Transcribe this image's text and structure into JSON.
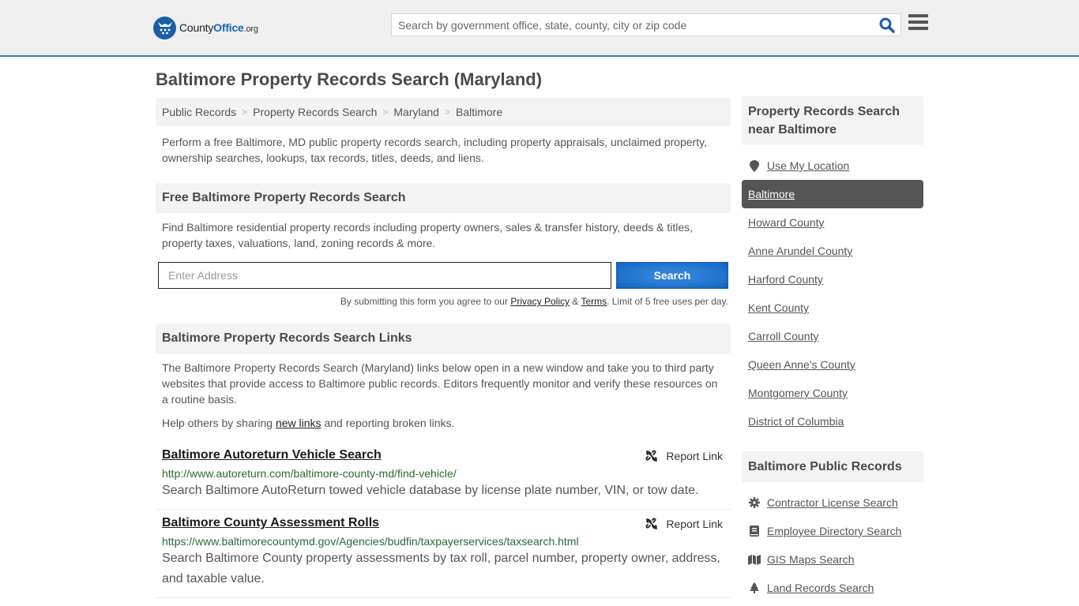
{
  "header": {
    "logo": {
      "name_plain": "County",
      "name_brand": "Office",
      "tld": ".org"
    },
    "search_placeholder": "Search by government office, state, county, city or zip code",
    "search_icon": "search-icon",
    "menu_icon": "hamburger-menu-icon",
    "accent_color": "#3a7ead"
  },
  "page_title": "Baltimore Property Records Search (Maryland)",
  "breadcrumb": [
    {
      "label": "Public Records"
    },
    {
      "label": "Property Records Search"
    },
    {
      "label": "Maryland"
    },
    {
      "label": "Baltimore"
    }
  ],
  "breadcrumb_separator": ">",
  "intro": "Perform a free Baltimore, MD public property records search, including property appraisals, unclaimed property, ownership searches, lookups, tax records, titles, deeds, and liens.",
  "search_section": {
    "heading": "Free Baltimore Property Records Search",
    "description": "Find Baltimore residential property records including property owners, sales & transfer history, deeds & titles, property taxes, valuations, land, zoning records & more.",
    "address_placeholder": "Enter Address",
    "button_label": "Search",
    "button_color": "#1a6fcf",
    "terms_prefix": "By submitting this form you agree to our ",
    "privacy_label": "Privacy Policy",
    "terms_amp": " & ",
    "terms_label": "Terms",
    "terms_suffix": ". Limit of 5 free uses per day."
  },
  "links_section": {
    "heading": "Baltimore Property Records Search Links",
    "description": "The Baltimore Property Records Search (Maryland) links below open in a new window and take you to third party websites that provide access to Baltimore public records. Editors frequently monitor and verify these resources on a routine basis.",
    "help_prefix": "Help others by sharing ",
    "help_link": "new links",
    "help_suffix": " and reporting broken links.",
    "report_label": "Report Link",
    "items": [
      {
        "title": "Baltimore Autoreturn Vehicle Search",
        "url": "http://www.autoreturn.com/baltimore-county-md/find-vehicle/",
        "description": "Search Baltimore AutoReturn towed vehicle database by license plate number, VIN, or tow date."
      },
      {
        "title": "Baltimore County Assessment Rolls",
        "url": "https://www.baltimorecountymd.gov/Agencies/budfin/taxpayerservices/taxsearch.html",
        "description": "Search Baltimore County property assessments by tax roll, parcel number, property owner, address, and taxable value."
      }
    ]
  },
  "sidebar": {
    "nearby": {
      "heading": "Property Records Search near Baltimore",
      "use_location": "Use My Location",
      "items": [
        {
          "label": "Baltimore",
          "active": true
        },
        {
          "label": "Howard County"
        },
        {
          "label": "Anne Arundel County"
        },
        {
          "label": "Harford County"
        },
        {
          "label": "Kent County"
        },
        {
          "label": "Carroll County"
        },
        {
          "label": "Queen Anne's County"
        },
        {
          "label": "Montgomery County"
        },
        {
          "label": "District of Columbia"
        }
      ]
    },
    "public_records": {
      "heading": "Baltimore Public Records",
      "items": [
        {
          "label": "Contractor License Search",
          "icon": "gear-icon"
        },
        {
          "label": "Employee Directory Search",
          "icon": "book-icon"
        },
        {
          "label": "GIS Maps Search",
          "icon": "map-icon"
        },
        {
          "label": "Land Records Search",
          "icon": "tree-icon"
        }
      ]
    }
  }
}
